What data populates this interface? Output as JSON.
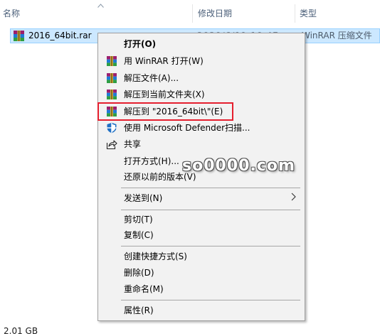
{
  "columns": {
    "name": "名称",
    "date": "修改日期",
    "type": "类型"
  },
  "file": {
    "name": "2016_64bit.rar",
    "date": "2020/6/11 10:47",
    "type": "WinRAR 压缩文件"
  },
  "menu": {
    "items": {
      "open": "打开(O)",
      "open_winrar": "用 WinRAR 打开(W)",
      "extract_files": "解压文件(A)...",
      "extract_here": "解压到当前文件夹(X)",
      "extract_to": "解压到 \"2016_64bit\\\"(E)",
      "defender": "使用 Microsoft Defender扫描...",
      "share": "共享",
      "open_with": "打开方式(H)...",
      "restore": "还原以前的版本(V)",
      "send_to": "发送到(N)",
      "cut": "剪切(T)",
      "copy": "复制(C)",
      "create_shortcut": "创建快捷方式(S)",
      "delete": "删除(D)",
      "rename": "重命名(M)",
      "properties": "属性(R)"
    }
  },
  "watermark": "so0000.com",
  "status": "2.01 GB",
  "colors": {
    "selection_bg": "#cce8ff",
    "selection_border": "#99d1ff",
    "menu_bg": "#f2f2f2",
    "highlight_red": "#e51f2e"
  }
}
